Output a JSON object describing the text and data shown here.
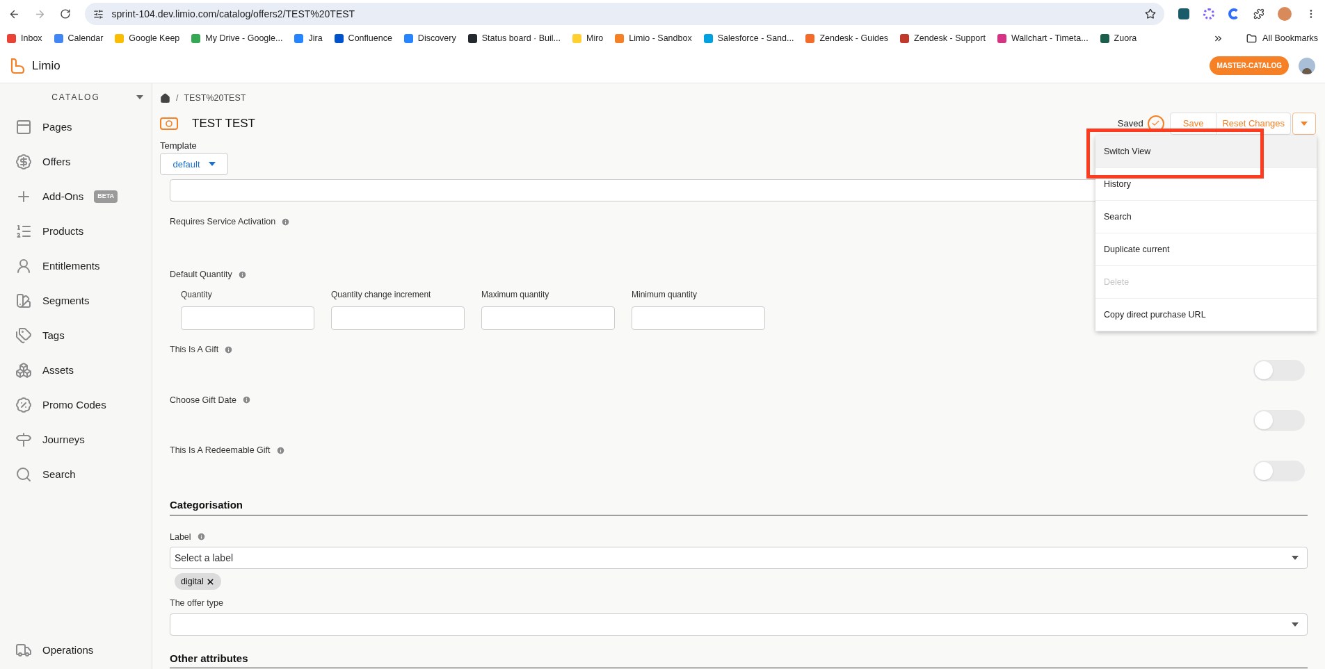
{
  "browser": {
    "url": "sprint-104.dev.limio.com/catalog/offers2/TEST%20TEST",
    "bookmarks": [
      "Inbox",
      "Calendar",
      "Google Keep",
      "My Drive - Google...",
      "Jira",
      "Confluence",
      "Discovery",
      "Status board · Buil...",
      "Miro",
      "Limio - Sandbox",
      "Salesforce - Sand...",
      "Zendesk - Guides",
      "Zendesk - Support",
      "Wallchart - Timeta...",
      "Zuora"
    ],
    "all_bookmarks": "All Bookmarks"
  },
  "app": {
    "name": "Limio",
    "catalog_badge": "MASTER-CATALOG"
  },
  "sidebar": {
    "heading": "CATALOG",
    "items": [
      {
        "label": "Pages"
      },
      {
        "label": "Offers"
      },
      {
        "label": "Add-Ons",
        "badge": "BETA"
      },
      {
        "label": "Products"
      },
      {
        "label": "Entitlements"
      },
      {
        "label": "Segments"
      },
      {
        "label": "Tags"
      },
      {
        "label": "Assets"
      },
      {
        "label": "Promo Codes"
      },
      {
        "label": "Journeys"
      },
      {
        "label": "Search"
      }
    ],
    "footer_item": {
      "label": "Operations"
    }
  },
  "breadcrumb": {
    "separator": "/",
    "current": "TEST%20TEST"
  },
  "title": "TEST TEST",
  "status": "Saved",
  "actions": {
    "save": "Save",
    "reset": "Reset Changes"
  },
  "menu": [
    {
      "label": "Switch View",
      "selected": true,
      "disabled": false
    },
    {
      "label": "History",
      "selected": false,
      "disabled": false
    },
    {
      "label": "Search",
      "selected": false,
      "disabled": false
    },
    {
      "label": "Duplicate current",
      "selected": false,
      "disabled": false
    },
    {
      "label": "Delete",
      "selected": false,
      "disabled": true
    },
    {
      "label": "Copy direct purchase URL",
      "selected": false,
      "disabled": false
    }
  ],
  "template": {
    "label": "Template",
    "value": "default"
  },
  "requires_service_activation": "Requires Service Activation",
  "default_quantity": {
    "label": "Default Quantity",
    "fields": [
      "Quantity",
      "Quantity change increment",
      "Maximum quantity",
      "Minimum quantity"
    ]
  },
  "toggles": [
    {
      "label": "This Is A Gift",
      "on": false
    },
    {
      "label": "Choose Gift Date",
      "on": false
    },
    {
      "label": "This Is A Redeemable Gift",
      "on": false
    }
  ],
  "categorisation": {
    "heading": "Categorisation",
    "label_field": {
      "label": "Label",
      "placeholder": "Select a label"
    },
    "chips": [
      "digital"
    ],
    "offer_type": {
      "label": "The offer type"
    }
  },
  "other_heading": "Other attributes"
}
